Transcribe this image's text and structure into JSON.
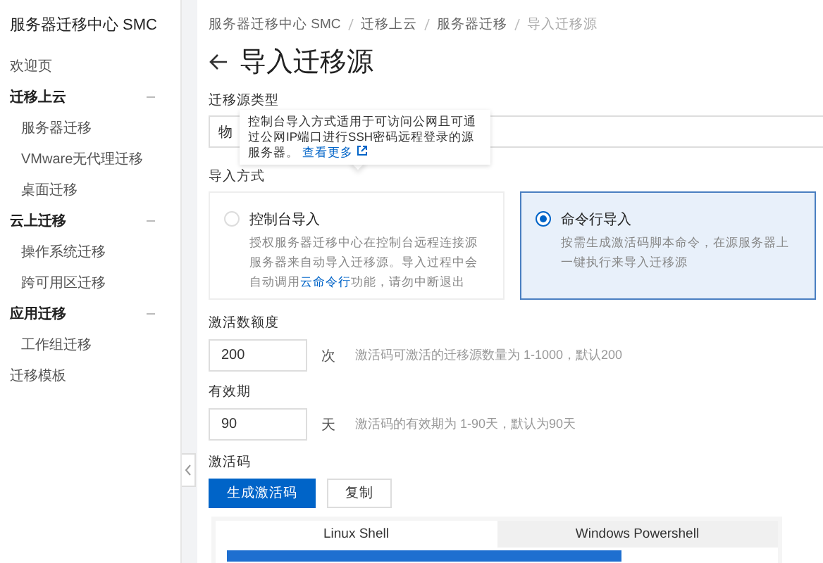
{
  "sidebar": {
    "title": "服务器迁移中心 SMC",
    "items": [
      {
        "kind": "link",
        "label": "欢迎页"
      },
      {
        "kind": "group",
        "label": "迁移上云",
        "expanded": true,
        "children": [
          {
            "label": "服务器迁移"
          },
          {
            "label": "VMware无代理迁移"
          },
          {
            "label": "桌面迁移"
          }
        ]
      },
      {
        "kind": "group",
        "label": "云上迁移",
        "expanded": true,
        "children": [
          {
            "label": "操作系统迁移"
          },
          {
            "label": "跨可用区迁移"
          }
        ]
      },
      {
        "kind": "group",
        "label": "应用迁移",
        "expanded": true,
        "children": [
          {
            "label": "工作组迁移"
          }
        ]
      },
      {
        "kind": "link",
        "label": "迁移模板"
      }
    ]
  },
  "breadcrumb": [
    "服务器迁移中心 SMC",
    "迁移上云",
    "服务器迁移",
    "导入迁移源"
  ],
  "page_title": "导入迁移源",
  "source_type": {
    "label": "迁移源类型",
    "value": "物"
  },
  "tooltip": {
    "text": "控制台导入方式适用于可访问公网且可通过公网IP端口进行SSH密码远程登录的源服务器。",
    "link": "查看更多"
  },
  "import_method": {
    "label": "导入方式",
    "options": [
      {
        "title": "控制台导入",
        "selected": false,
        "description": "授权服务器迁移中心在控制台远程连接源服务器来自动导入迁移源。导入过程中会自动调用",
        "link": "云命令行",
        "description_after": "功能，请勿中断退出"
      },
      {
        "title": "命令行导入",
        "selected": true,
        "description": "按需生成激活码脚本命令，在源服务器上一键执行来导入迁移源"
      }
    ]
  },
  "fields": [
    {
      "label": "激活数额度",
      "value": "200",
      "unit": "次",
      "hint": "激活码可激活的迁移源数量为 1-1000，默认200"
    },
    {
      "label": "有效期",
      "value": "90",
      "unit": "天",
      "hint": "激活码的有效期为 1-90天，默认为90天"
    }
  ],
  "activation_code": {
    "label": "激活码",
    "buttons": [
      {
        "label": "生成激活码",
        "kind": "primary"
      },
      {
        "label": "复制",
        "kind": "secondary"
      }
    ],
    "tabs": [
      {
        "label": "Linux Shell",
        "selected": true
      },
      {
        "label": "Windows Powershell",
        "selected": false
      }
    ]
  }
}
